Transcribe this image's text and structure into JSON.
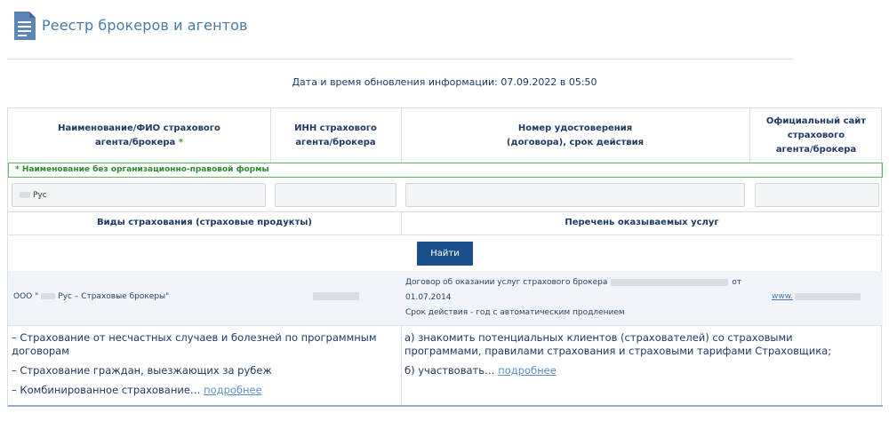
{
  "header": {
    "title": "Реестр брокеров и агентов",
    "icon": "document-icon"
  },
  "updated": "Дата и время обновления информации: 07.09.2022 в 05:50",
  "table": {
    "col_name_line1": "Наименование/ФИО страхового",
    "col_name_line2": "агента/брокера",
    "col_name_star": " *",
    "col_inn_line1": "ИНН страхового",
    "col_inn_line2": "агента/брокера",
    "col_cert_line1": "Номер удостоверения",
    "col_cert_line2": "(договора), срок действия",
    "col_site_line1": "Официальный сайт",
    "col_site_line2": "страхового",
    "col_site_line3": "агента/брокера",
    "note": "* Наименование без организационно-правовой формы",
    "filters": {
      "name_value": "Рус",
      "inn_value": "",
      "cert_value": "",
      "site_value": ""
    },
    "col_types": "Виды страхования (страховые продукты)",
    "col_services": "Перечень оказываемых услуг",
    "find_button": "Найти"
  },
  "result": {
    "name_prefix": "ООО \"",
    "name_suffix": "Рус – Страховые брокеры\"",
    "cert_line1": "Договор об оказании услуг страхового брокера",
    "cert_ot": "от",
    "cert_date": "01.07.2014",
    "cert_term": "Срок действия - год с автоматическим продлением",
    "site_prefix": "www."
  },
  "details": {
    "types_1": "– Страхование от несчастных случаев и болезней по программным договорам",
    "types_2": "– Страхование граждан, выезжающих за рубеж",
    "types_3": "– Комбинированное страхование…",
    "types_more": "подробнее",
    "services_1": "а) знакомить потенциальных клиентов (страхователей) со страховыми программами, правилами страхования и страховыми тарифами Страховщика;",
    "services_2": "б) участвовать…",
    "services_more": "подробнее"
  },
  "colors": {
    "title": "#4a79a8",
    "button": "#1b4f8a",
    "note_border": "#5cb85c",
    "link": "#5b8fc7"
  }
}
